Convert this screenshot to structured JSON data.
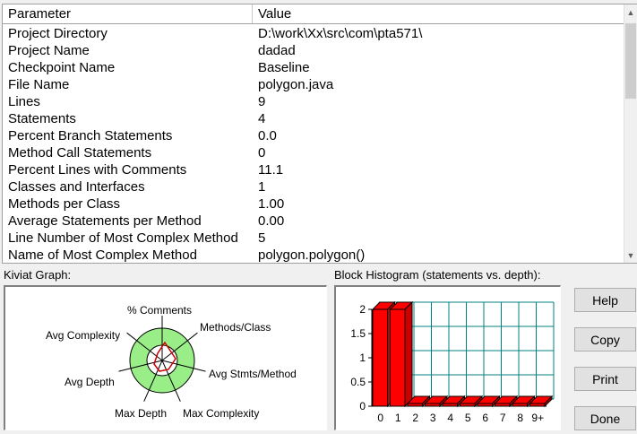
{
  "table": {
    "headers": {
      "parameter": "Parameter",
      "value": "Value"
    },
    "rows": [
      {
        "param": "Project Directory",
        "value": "D:\\work\\Xx\\src\\com\\pta571\\"
      },
      {
        "param": "Project Name",
        "value": "dadad"
      },
      {
        "param": "Checkpoint Name",
        "value": "Baseline"
      },
      {
        "param": "File Name",
        "value": "polygon.java"
      },
      {
        "param": "Lines",
        "value": "9"
      },
      {
        "param": "Statements",
        "value": "4"
      },
      {
        "param": "Percent Branch Statements",
        "value": "0.0"
      },
      {
        "param": "Method Call Statements",
        "value": "0"
      },
      {
        "param": "Percent Lines with Comments",
        "value": "11.1"
      },
      {
        "param": "Classes and Interfaces",
        "value": "1"
      },
      {
        "param": "Methods per Class",
        "value": "1.00"
      },
      {
        "param": "Average Statements per Method",
        "value": "0.00"
      },
      {
        "param": "Line Number of Most Complex Method",
        "value": "5"
      },
      {
        "param": "Name of Most Complex Method",
        "value": "polygon.polygon()"
      }
    ]
  },
  "kiviat": {
    "title": "Kiviat Graph:",
    "axes": {
      "comments": "% Comments",
      "methods_class": "Methods/Class",
      "avg_stmts": "Avg Stmts/Method",
      "max_complexity": "Max Complexity",
      "max_depth": "Max Depth",
      "avg_depth": "Avg Depth",
      "avg_complexity": "Avg Complexity"
    },
    "colors": {
      "band": "#99ee88",
      "line": "#000000",
      "marker": "#cc0000"
    }
  },
  "histogram": {
    "title": "Block Histogram (statements vs. depth):",
    "colors": {
      "bar": "#ff0000",
      "grid": "#008080"
    }
  },
  "chart_data": {
    "type": "bar",
    "title": "Block Histogram (statements vs. depth):",
    "categories": [
      "0",
      "1",
      "2",
      "3",
      "4",
      "5",
      "6",
      "7",
      "8",
      "9+"
    ],
    "values": [
      2,
      2,
      0,
      0,
      0,
      0,
      0,
      0,
      0,
      0
    ],
    "ylim": [
      0,
      2
    ],
    "yticks": [
      "0",
      "0.5",
      "1",
      "1.5",
      "2"
    ],
    "grid": true
  },
  "buttons": {
    "help": "Help",
    "copy": "Copy",
    "print": "Print",
    "done": "Done"
  }
}
